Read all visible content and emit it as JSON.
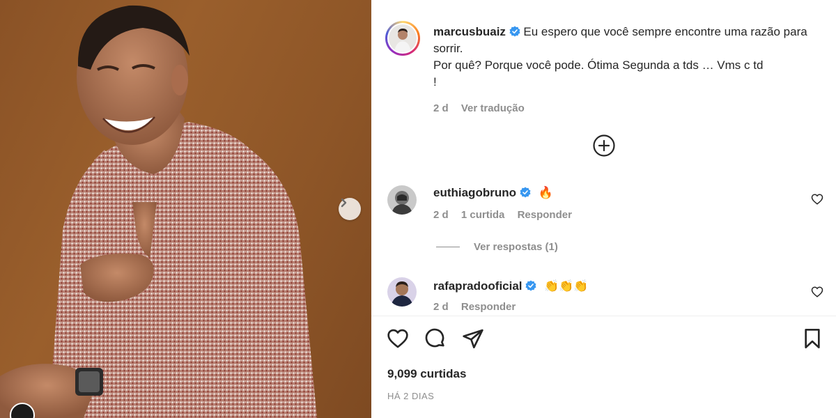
{
  "post": {
    "author": "marcusbuaiz",
    "caption": "Eu espero que você sempre encontre uma razão para sorrir.\nPor quê? Porque você pode. Ótima Segunda a tds … Vms c td\n!",
    "age": "2 d",
    "translate_label": "Ver tradução",
    "likes": "9,099 curtidas",
    "timestamp": "HÁ 2 DIAS"
  },
  "comments": [
    {
      "user": "euthiagobruno",
      "text": "🔥",
      "age": "2 d",
      "likes": "1 curtida",
      "reply_label": "Responder",
      "view_replies": "Ver respostas (1)"
    },
    {
      "user": "rafapradooficial",
      "text": "👏👏👏",
      "age": "2 d",
      "reply_label": "Responder"
    }
  ],
  "icons": {
    "verified": "verified-badge-icon",
    "plus": "add-circle-icon",
    "like": "heart-icon",
    "comment": "comment-icon",
    "share": "paper-plane-icon",
    "save": "bookmark-icon",
    "next": "chevron-right-icon"
  },
  "colors": {
    "verified_blue": "#3897f0",
    "text": "#262626",
    "muted": "#8e8e8e",
    "photo_background": "#8d5527"
  }
}
